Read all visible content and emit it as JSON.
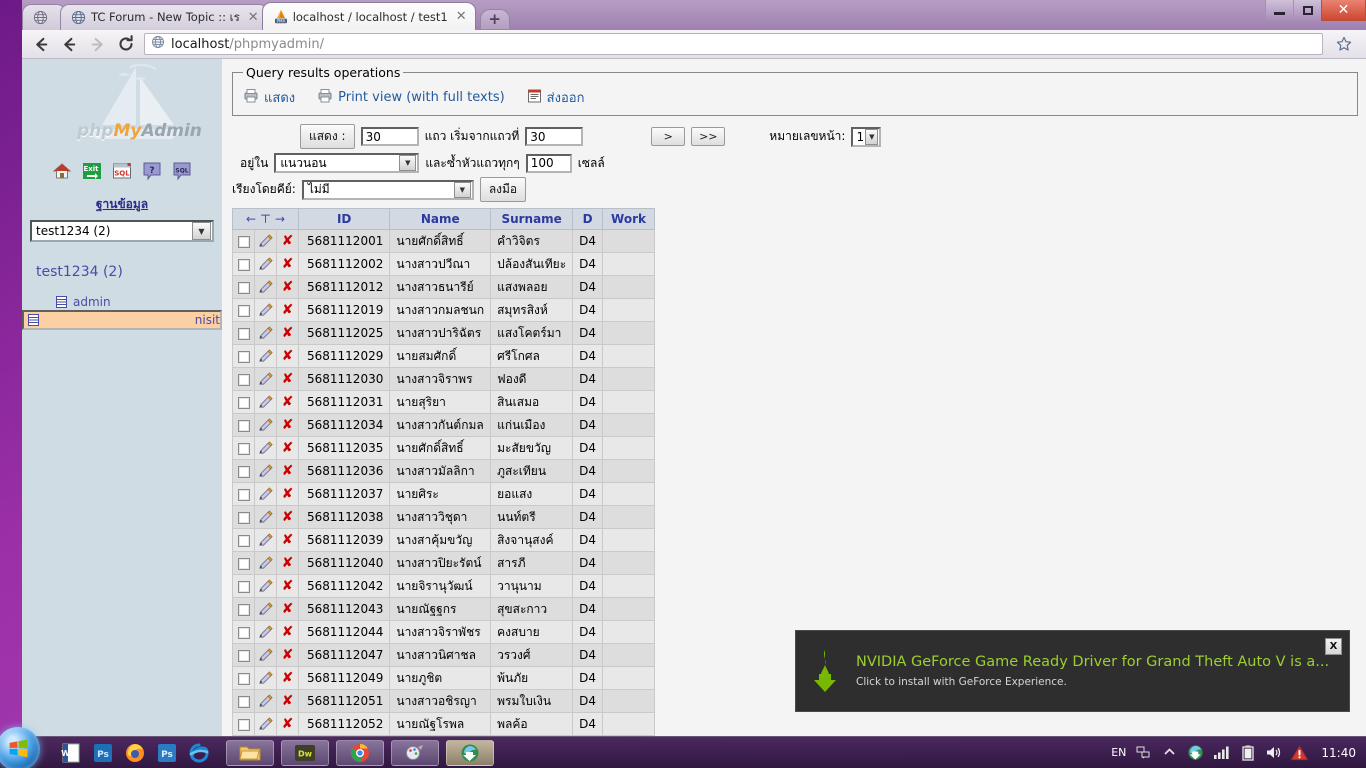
{
  "browser": {
    "tabs": [
      {
        "title": "",
        "favicon": "globe-icon",
        "partial": true,
        "active": false
      },
      {
        "title": "TC Forum - New Topic :: เร",
        "favicon": "globe-icon",
        "partial": false,
        "active": false
      },
      {
        "title": "localhost / localhost / test1",
        "favicon": "phpmyadmin-icon",
        "partial": false,
        "active": true
      }
    ],
    "new_tab_label": "+",
    "window_controls": {
      "minimize": "minimize",
      "maximize": "maximize",
      "close": "✕"
    },
    "nav": {
      "back": "back-arrow",
      "forward": "forward-arrow",
      "reload": "reload-icon",
      "url_bold": "localhost",
      "url_dim": "/phpmyadmin/",
      "star": "star-icon"
    }
  },
  "sidebar": {
    "logo": {
      "php": "php",
      "my": "My",
      "admin": "Admin"
    },
    "icons": [
      "home-icon",
      "exit-icon",
      "sql-icon",
      "help-icon",
      "sql-query-icon"
    ],
    "db_heading": "ฐานข้อมูล",
    "db_select_value": "test1234 (2)",
    "db_name": "test1234 (2)",
    "tables": [
      {
        "name": "admin",
        "selected": false
      },
      {
        "name": "nisit",
        "selected": true
      }
    ]
  },
  "query_ops": {
    "legend": "Query results operations",
    "actions": [
      {
        "label": "แสดง",
        "icon": "print-icon"
      },
      {
        "label": "Print view (with full texts)",
        "icon": "print-icon"
      },
      {
        "label": "ส่งออก",
        "icon": "export-icon"
      }
    ]
  },
  "controls": {
    "show_button": "แสดง :",
    "show_count": "30",
    "rows_label": "แถว เริ่มจากแถวที่",
    "start_row": "30",
    "next_button": ">",
    "last_button": ">>",
    "page_label": "หมายเลขหน้า:",
    "page_value": "1",
    "in_label": "อยู่ใน",
    "in_value": "แนวนอน",
    "repeat_label": "และซ้ำหัวแถวทุกๆ",
    "repeat_value": "100",
    "cells_label": "เซลล์",
    "sort_label": "เรียงโดยคีย์:",
    "sort_value": "ไม่มี",
    "go_button": "ลงมือ"
  },
  "table": {
    "nav_header": "← T →",
    "columns": [
      "ID",
      "Name",
      "Surname",
      "D",
      "Work"
    ],
    "rows": [
      {
        "id": "5681112001",
        "name": "นายศักดิ์สิทธิ์",
        "surname": "คำวิจิตร",
        "d": "D4",
        "work": ""
      },
      {
        "id": "5681112002",
        "name": "นางสาวปวีณา",
        "surname": "ปล้องสันเทียะ",
        "d": "D4",
        "work": ""
      },
      {
        "id": "5681112012",
        "name": "นางสาวธนารีย์",
        "surname": "แสงพลอย",
        "d": "D4",
        "work": ""
      },
      {
        "id": "5681112019",
        "name": "นางสาวกมลชนก",
        "surname": "สมุทรสิงห์",
        "d": "D4",
        "work": ""
      },
      {
        "id": "5681112025",
        "name": "นางสาวปาริฉัตร",
        "surname": "แสงโคตร์มา",
        "d": "D4",
        "work": ""
      },
      {
        "id": "5681112029",
        "name": "นายสมศักดิ์",
        "surname": "ศรีโกศล",
        "d": "D4",
        "work": ""
      },
      {
        "id": "5681112030",
        "name": "นางสาวจิราพร",
        "surname": "ฟองดี",
        "d": "D4",
        "work": ""
      },
      {
        "id": "5681112031",
        "name": "นายสุริยา",
        "surname": "สินเสมอ",
        "d": "D4",
        "work": ""
      },
      {
        "id": "5681112034",
        "name": "นางสาวกันต์กมล",
        "surname": "แก่นเมือง",
        "d": "D4",
        "work": ""
      },
      {
        "id": "5681112035",
        "name": "นายศักดิ์สิทธิ์",
        "surname": "มะสัยขวัญ",
        "d": "D4",
        "work": ""
      },
      {
        "id": "5681112036",
        "name": "นางสาวมัลลิกา",
        "surname": "ภูสะเทียน",
        "d": "D4",
        "work": ""
      },
      {
        "id": "5681112037",
        "name": "นายศิระ",
        "surname": "ยอแสง",
        "d": "D4",
        "work": ""
      },
      {
        "id": "5681112038",
        "name": "นางสาววิชุดา",
        "surname": "นนท์ตรี",
        "d": "D4",
        "work": ""
      },
      {
        "id": "5681112039",
        "name": "นางสาคุ้มขวัญ",
        "surname": "สิงจานุสงค์",
        "d": "D4",
        "work": ""
      },
      {
        "id": "5681112040",
        "name": "นางสาวปิยะรัตน์",
        "surname": "สารภี",
        "d": "D4",
        "work": ""
      },
      {
        "id": "5681112042",
        "name": "นายจิรานุวัฒน์",
        "surname": "วานุนาม",
        "d": "D4",
        "work": ""
      },
      {
        "id": "5681112043",
        "name": "นายณัฐฐกร",
        "surname": "สุขสะกาว",
        "d": "D4",
        "work": ""
      },
      {
        "id": "5681112044",
        "name": "นางสาวจิราพัชร",
        "surname": "คงสบาย",
        "d": "D4",
        "work": ""
      },
      {
        "id": "5681112047",
        "name": "นางสาวนิศาชล",
        "surname": "วรวงศ์",
        "d": "D4",
        "work": ""
      },
      {
        "id": "5681112049",
        "name": "นายภูชิต",
        "surname": "พ้นภัย",
        "d": "D4",
        "work": ""
      },
      {
        "id": "5681112051",
        "name": "นางสาวอชิรญา",
        "surname": "พรมใบเงิน",
        "d": "D4",
        "work": ""
      },
      {
        "id": "5681112052",
        "name": "นายณัฐโรพล",
        "surname": "พลค้อ",
        "d": "D4",
        "work": ""
      }
    ]
  },
  "toast": {
    "icon": "nvidia-download-icon",
    "title": "NVIDIA GeForce Game Ready Driver for Grand Theft Auto V is a...",
    "subtitle": "Click to install with GeForce Experience.",
    "close": "X"
  },
  "taskbar": {
    "start": "windows-start-orb",
    "pinned": [
      "word-icon",
      "photoshop-icon",
      "firefox-icon",
      "photoshop2-icon",
      "internet-explorer-icon"
    ],
    "windows": [
      "explorer-icon",
      "dreamweaver-icon",
      "chrome-icon",
      "paint-icon",
      "idm-icon"
    ],
    "tray": {
      "language": "EN",
      "icons": [
        "network-tray-icon",
        "show-hidden-icon",
        "idm-tray-icon",
        "signal-icon",
        "battery-icon",
        "volume-icon",
        "warning-icon"
      ],
      "clock": "11:40"
    }
  },
  "colors": {
    "desktop": "#9b2fa8",
    "sidebar_bg": "#d0dce3",
    "table_header": "#d3d9e3",
    "selected_row": "#fcd0a2",
    "link": "#235a9e",
    "nvidia_green": "#9ccf2f"
  }
}
